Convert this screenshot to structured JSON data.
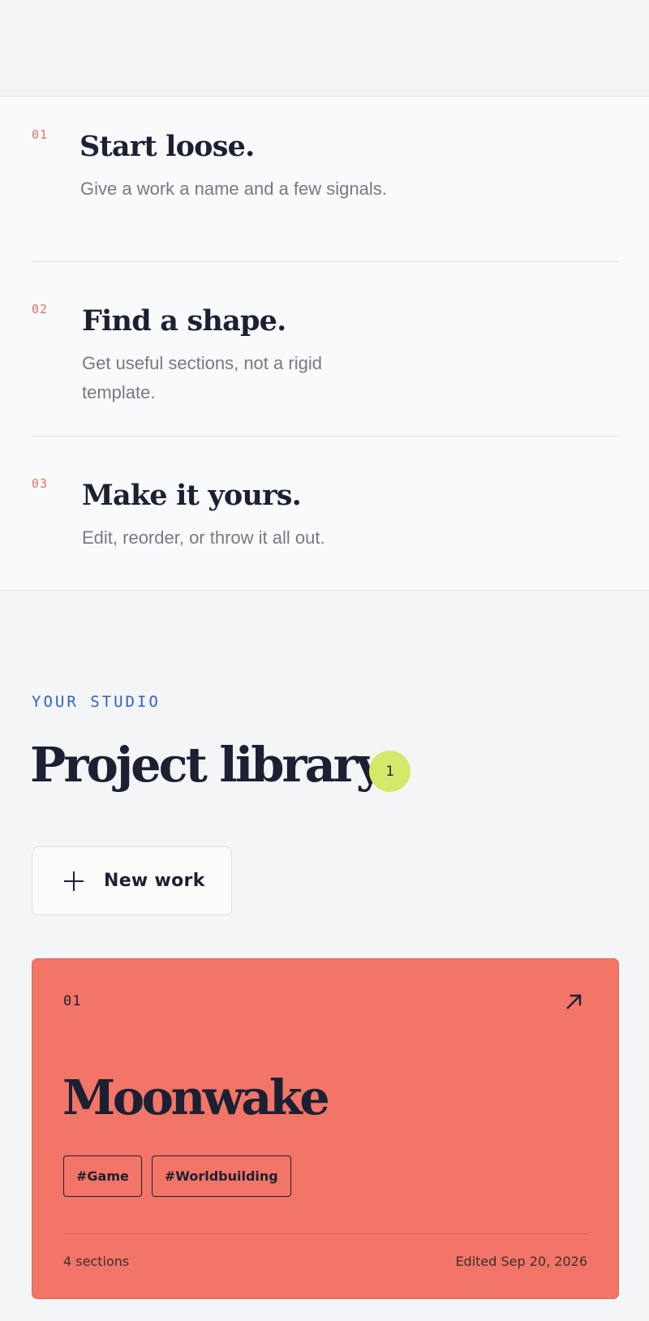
{
  "steps": [
    {
      "num": "01",
      "title": "Start loose.",
      "desc": "Give a work a name and a few signals."
    },
    {
      "num": "02",
      "title": "Find a shape.",
      "desc": "Get useful sections, not a rigid template."
    },
    {
      "num": "03",
      "title": "Make it yours.",
      "desc": "Edit, reorder, or throw it all out."
    }
  ],
  "library": {
    "eyebrow": "YOUR STUDIO",
    "title": "Project library",
    "count": "1",
    "new_work_label": "New work"
  },
  "projects": [
    {
      "num": "01",
      "title": "Moonwake",
      "tags": [
        "#Game",
        "#Worldbuilding"
      ],
      "sections": "4 sections",
      "edited": "Edited Sep 20, 2026",
      "color": "#f27567",
      "open_icon": "arrow-up-right-icon"
    }
  ],
  "colors": {
    "accent_number": "#ea6f5f",
    "eyebrow": "#2f62c9",
    "badge": "#d6e86a",
    "ink": "#1c2033"
  }
}
